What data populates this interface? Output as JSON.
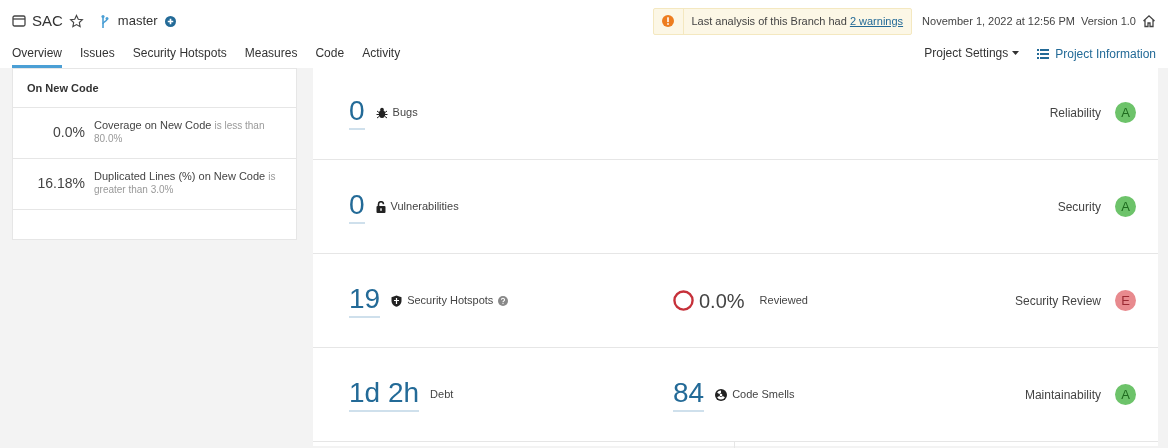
{
  "header": {
    "project": "SAC",
    "branch": "master",
    "warning": {
      "text": "Last analysis of this Branch had",
      "link": "2 warnings"
    },
    "date": "November 1, 2022 at 12:56 PM",
    "version": "Version 1.0"
  },
  "tabs": [
    {
      "label": "Overview",
      "selected": true
    },
    {
      "label": "Issues",
      "selected": false
    },
    {
      "label": "Security Hotspots",
      "selected": false
    },
    {
      "label": "Measures",
      "selected": false
    },
    {
      "label": "Code",
      "selected": false
    },
    {
      "label": "Activity",
      "selected": false
    }
  ],
  "project_settings": "Project Settings",
  "project_information": "Project Information",
  "quality_gate": {
    "title": "On New Code",
    "conditions": [
      {
        "value": "0.0%",
        "metric": "Coverage on New Code",
        "condition": "is less than 80.0%"
      },
      {
        "value": "16.18%",
        "metric": "Duplicated Lines (%) on New Code",
        "condition": "is greater than 3.0%"
      }
    ]
  },
  "measures": [
    {
      "kind": "bugs",
      "value": "0",
      "label": "Bugs",
      "rating_label": "Reliability",
      "grade": "A",
      "color": "#6dc36a"
    },
    {
      "kind": "vulnerabilities",
      "value": "0",
      "label": "Vulnerabilities",
      "rating_label": "Security",
      "grade": "A",
      "color": "#6dc36a"
    },
    {
      "kind": "hotspots",
      "value": "19",
      "label": "Security Hotspots",
      "secondary": {
        "value": "0.0%",
        "label": "Reviewed"
      },
      "rating_label": "Security Review",
      "grade": "E",
      "color": "#e88a8e"
    },
    {
      "kind": "debt",
      "value": "1d 2h",
      "label": "Debt",
      "secondary": {
        "value": "84",
        "label": "Code Smells"
      },
      "rating_label": "Maintainability",
      "grade": "A",
      "color": "#6dc36a"
    }
  ]
}
